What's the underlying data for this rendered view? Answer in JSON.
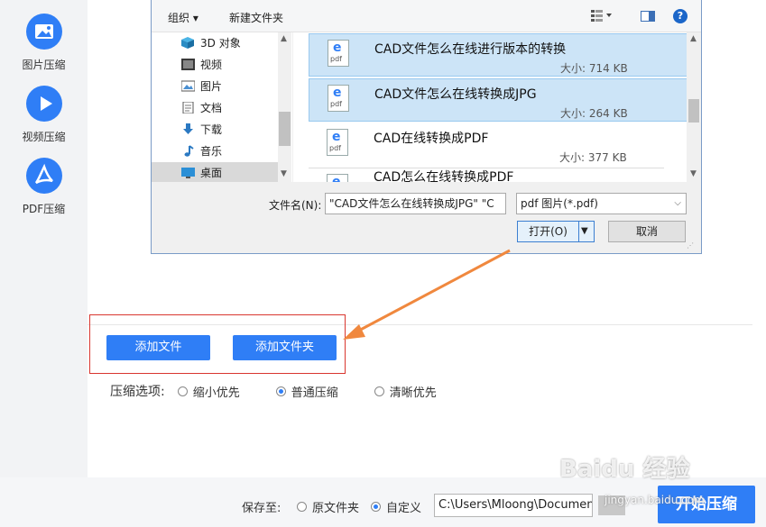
{
  "sidebar": {
    "items": [
      {
        "label": "图片压缩",
        "icon": "image-icon"
      },
      {
        "label": "视频压缩",
        "icon": "play-icon"
      },
      {
        "label": "PDF压缩",
        "icon": "pdf-icon"
      }
    ]
  },
  "dialog": {
    "toolbar": {
      "organize": "组织",
      "new_folder": "新建文件夹"
    },
    "nav": [
      {
        "label": "3D 对象",
        "icon": "3d-objects-icon"
      },
      {
        "label": "视频",
        "icon": "video-folder-icon"
      },
      {
        "label": "图片",
        "icon": "pictures-folder-icon"
      },
      {
        "label": "文档",
        "icon": "documents-folder-icon"
      },
      {
        "label": "下载",
        "icon": "download-folder-icon"
      },
      {
        "label": "音乐",
        "icon": "music-folder-icon"
      },
      {
        "label": "桌面",
        "icon": "desktop-folder-icon",
        "selected": true
      }
    ],
    "files": [
      {
        "name": "CAD文件怎么在线进行版本的转换",
        "size": "大小: 714 KB",
        "selected": true
      },
      {
        "name": "CAD文件怎么在线转换成JPG",
        "size": "大小: 264 KB",
        "selected": true
      },
      {
        "name": "CAD在线转换成PDF",
        "size": "大小: 377 KB",
        "selected": false
      },
      {
        "name": "CAD怎么在线转换成PDF",
        "size": "",
        "selected": false
      }
    ],
    "filename_label": "文件名(N):",
    "filename_value": "\"CAD文件怎么在线转换成JPG\" \"C",
    "filetype_value": "pdf 图片(*.pdf)",
    "open_label": "打开(O)",
    "cancel_label": "取消"
  },
  "main": {
    "add_file": "添加文件",
    "add_folder": "添加文件夹",
    "options_title": "压缩选项:",
    "options": [
      {
        "label": "缩小优先",
        "selected": false
      },
      {
        "label": "普通压缩",
        "selected": true
      },
      {
        "label": "清晰优先",
        "selected": false
      }
    ]
  },
  "bottom": {
    "save_to": "保存至:",
    "original_folder": "原文件夹",
    "custom": "自定义",
    "path": "C:\\Users\\Mloong\\Documents",
    "start": "开始压缩"
  },
  "watermark": {
    "brand": "Baidu 经验",
    "url": "jingyan.baidu.com"
  },
  "colors": {
    "accent": "#2f7ef6",
    "highlight_box": "#d9362f",
    "arrow": "#f0883e"
  }
}
